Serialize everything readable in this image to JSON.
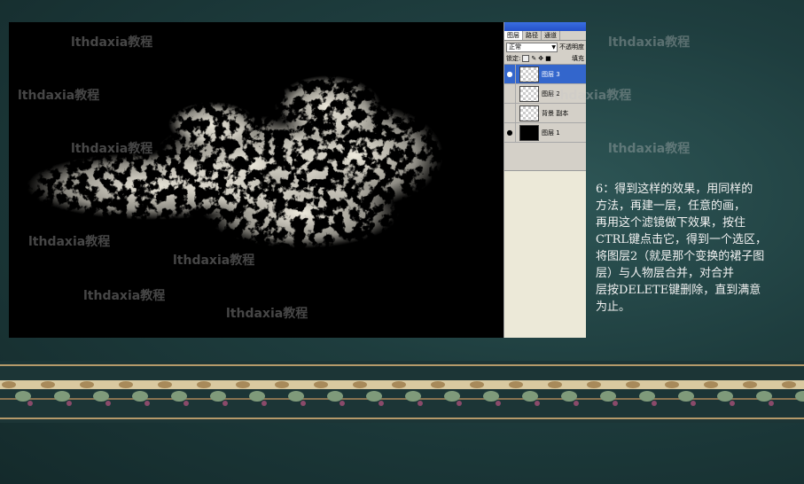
{
  "watermark_text": "lthdaxia教程",
  "layers_panel": {
    "tabs": [
      "图层",
      "路径",
      "通道"
    ],
    "blend_mode": "正常",
    "opacity_label": "不透明度",
    "lock_label": "锁定:",
    "fill_label": "填充",
    "layers": [
      {
        "name": "图层 3",
        "visible": true,
        "selected": true
      },
      {
        "name": "图层 2",
        "visible": false,
        "selected": false
      },
      {
        "name": "背景 副本",
        "visible": false,
        "selected": false
      },
      {
        "name": "图层 1",
        "visible": true,
        "selected": false
      }
    ]
  },
  "description": "6：得到这样的效果，用同样的\n方法，再建一层，任意的画，\n再用这个滤镜做下效果，按住\nCTRL键点击它，得到一个选区，\n将图层2（就是那个变换的裙子图\n层）与人物层合并，对合并\n层按DELETE键删除，直到满意\n为止。",
  "colors": {
    "background": "#1e3d3e",
    "panel_selected": "#3366cc",
    "text": "#f2f2f2"
  }
}
